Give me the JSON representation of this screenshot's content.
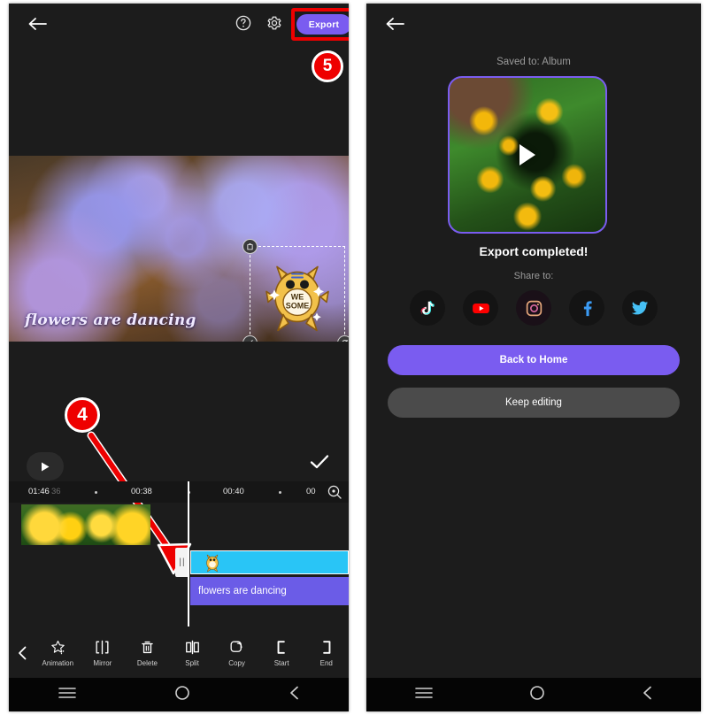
{
  "left_panel": {
    "topbar": {
      "back_icon": "back-arrow-icon",
      "help_icon": "help-circle-icon",
      "settings_icon": "gear-icon",
      "export_label": "Export"
    },
    "annotations": {
      "badge_export": "5",
      "badge_timeline": "4"
    },
    "preview": {
      "caption_text": "flowers are dancing",
      "sticker_line1": "WE",
      "sticker_line2": "SOME",
      "delete_handle_icon": "trash-icon",
      "scale_handle_icon": "scale-icon",
      "rotate_handle_icon": "rotate-icon"
    },
    "player": {
      "play_icon": "play-icon",
      "confirm_icon": "check-icon"
    },
    "timeline": {
      "ticks": [
        "01:46",
        "36",
        "00:38",
        "00:40",
        "00"
      ],
      "zoom_icon": "zoom-timeline-icon",
      "sticker_clip_label": "",
      "text_clip_label": "flowers are dancing",
      "trim_handle_icon": "trim-handle-icon"
    },
    "toolbar": {
      "back_icon": "chevron-left-icon",
      "items": [
        {
          "label": "Animation",
          "icon": "animation-star-icon"
        },
        {
          "label": "Mirror",
          "icon": "mirror-icon"
        },
        {
          "label": "Delete",
          "icon": "trash-icon"
        },
        {
          "label": "Split",
          "icon": "split-icon"
        },
        {
          "label": "Copy",
          "icon": "copy-icon"
        },
        {
          "label": "Start",
          "icon": "bracket-left-icon"
        },
        {
          "label": "End",
          "icon": "bracket-right-icon"
        }
      ]
    },
    "navbar": {
      "recents_icon": "menu-icon",
      "home_icon": "home-circle-icon",
      "back_icon": "nav-back-icon"
    }
  },
  "right_panel": {
    "topbar": {
      "back_icon": "back-arrow-icon"
    },
    "saved_to": "Saved to: Album",
    "thumbnail": {
      "play_icon": "play-icon"
    },
    "export_completed": "Export completed!",
    "share_label": "Share to:",
    "share_targets": [
      {
        "name": "tiktok",
        "icon": "tiktok-icon"
      },
      {
        "name": "youtube",
        "icon": "youtube-icon"
      },
      {
        "name": "instagram",
        "icon": "instagram-icon"
      },
      {
        "name": "facebook",
        "icon": "facebook-icon"
      },
      {
        "name": "twitter",
        "icon": "twitter-icon"
      }
    ],
    "back_home_label": "Back to Home",
    "keep_editing_label": "Keep editing",
    "navbar": {
      "recents_icon": "menu-icon",
      "home_icon": "home-circle-icon",
      "back_icon": "nav-back-icon"
    }
  },
  "colors": {
    "accent_purple": "#7a5cf0",
    "annotation_red": "#ee0000",
    "sticker_clip_cyan": "#29c5f6",
    "text_clip_purple": "#6b5ce7",
    "panel_bg": "#1c1c1c"
  }
}
